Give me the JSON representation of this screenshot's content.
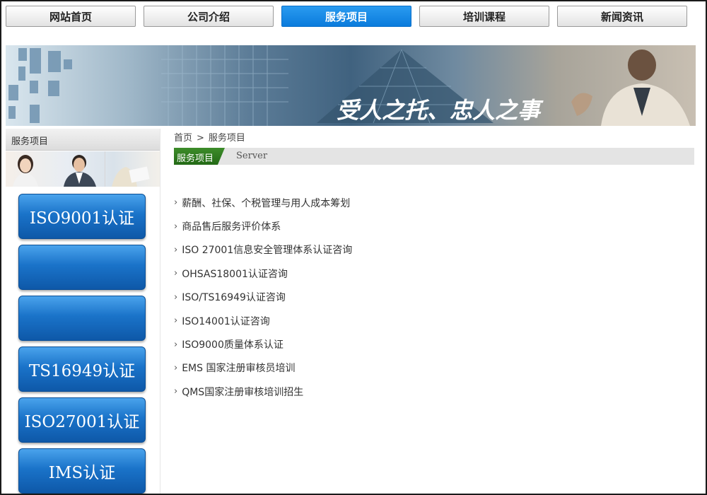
{
  "nav": {
    "items": [
      {
        "label": "网站首页"
      },
      {
        "label": "公司介绍"
      },
      {
        "label": "服务项目",
        "active": true
      },
      {
        "label": "培训课程"
      },
      {
        "label": "新闻资讯"
      }
    ]
  },
  "banner": {
    "slogan": "受人之托、忠人之事"
  },
  "sidebar": {
    "title": "服务项目",
    "buttons": [
      {
        "label": "ISO9001认证"
      },
      {
        "label": ""
      },
      {
        "label": ""
      },
      {
        "label": "TS16949认证"
      },
      {
        "label": "ISO27001认证"
      },
      {
        "label": "IMS认证"
      }
    ]
  },
  "breadcrumb": {
    "home": "首页",
    "separator": ">",
    "current": "服务项目"
  },
  "section": {
    "title": "服务项目",
    "subtitle": "Server"
  },
  "services": [
    "薪酬、社保、个税管理与用人成本筹划",
    "商品售后服务评价体系",
    "ISO 27001信息安全管理体系认证咨询",
    "OHSAS18001认证咨询",
    "ISO/TS16949认证咨询",
    "ISO14001认证咨询",
    "ISO9000质量体系认证",
    "EMS 国家注册审核员培训",
    "QMS国家注册审核培训招生"
  ],
  "colors": {
    "nav_active": "#0a7bdc",
    "sidebar_button": "#1a73c9",
    "section_tab": "#2f7a20"
  }
}
